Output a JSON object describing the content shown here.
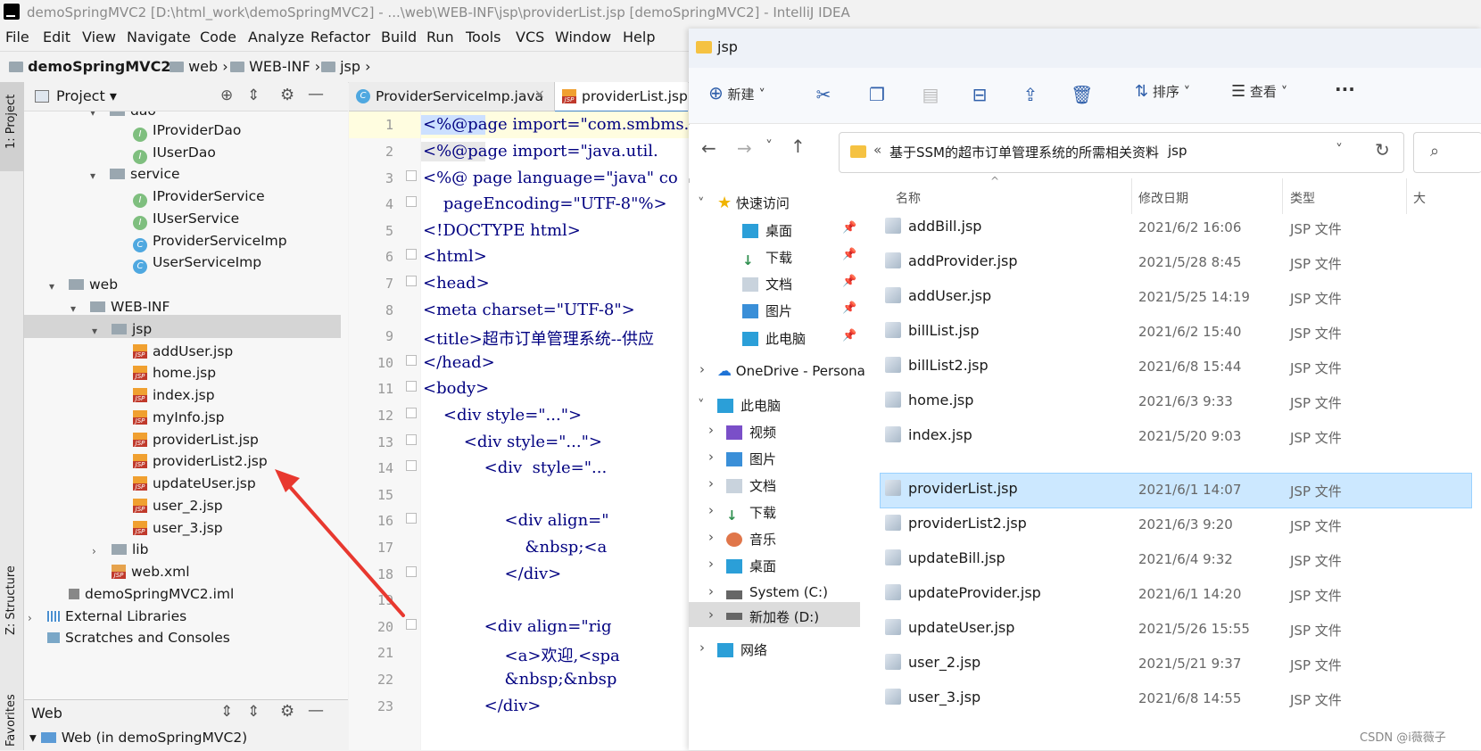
{
  "ide": {
    "title": "demoSpringMVC2 [D:\\html_work\\demoSpringMVC2] - ...\\web\\WEB-INF\\jsp\\providerList.jsp [demoSpringMVC2] - IntelliJ IDEA",
    "menu": [
      "File",
      "Edit",
      "View",
      "Navigate",
      "Code",
      "Analyze",
      "Refactor",
      "Build",
      "Run",
      "Tools",
      "VCS",
      "Window",
      "Help"
    ],
    "breadcrumb": [
      "demoSpringMVC2",
      "web",
      "WEB-INF",
      "jsp"
    ],
    "left_strip": {
      "project": "1: Project",
      "structure": "Z: Structure",
      "favorites": "Favorites"
    },
    "project_panel": {
      "title": "Project",
      "tree": [
        {
          "label": "dao",
          "icon": "folder"
        },
        {
          "label": "IProviderDao",
          "icon": "interface"
        },
        {
          "label": "IUserDao",
          "icon": "interface"
        },
        {
          "label": "service",
          "icon": "folder"
        },
        {
          "label": "IProviderService",
          "icon": "interface"
        },
        {
          "label": "IUserService",
          "icon": "interface"
        },
        {
          "label": "ProviderServiceImp",
          "icon": "class"
        },
        {
          "label": "UserServiceImp",
          "icon": "class"
        },
        {
          "label": "web",
          "icon": "folder"
        },
        {
          "label": "WEB-INF",
          "icon": "folder"
        },
        {
          "label": "jsp",
          "icon": "folder"
        },
        {
          "label": "addUser.jsp",
          "icon": "jsp"
        },
        {
          "label": "home.jsp",
          "icon": "jsp"
        },
        {
          "label": "index.jsp",
          "icon": "jsp"
        },
        {
          "label": "myInfo.jsp",
          "icon": "jsp"
        },
        {
          "label": "providerList.jsp",
          "icon": "jsp"
        },
        {
          "label": "providerList2.jsp",
          "icon": "jsp"
        },
        {
          "label": "updateUser.jsp",
          "icon": "jsp"
        },
        {
          "label": "user_2.jsp",
          "icon": "jsp"
        },
        {
          "label": "user_3.jsp",
          "icon": "jsp"
        },
        {
          "label": "lib",
          "icon": "folder"
        },
        {
          "label": "web.xml",
          "icon": "xml"
        },
        {
          "label": "demoSpringMVC2.iml",
          "icon": "iml"
        },
        {
          "label": "External Libraries",
          "icon": "library"
        },
        {
          "label": "Scratches and Consoles",
          "icon": "scratch"
        }
      ]
    },
    "web_panel": {
      "title": "Web",
      "item": "Web (in demoSpringMVC2)"
    },
    "editor_tabs": [
      "ProviderServiceImp.java",
      "providerList.jsp"
    ],
    "line_numbers": [
      "1",
      "2",
      "3",
      "4",
      "5",
      "6",
      "7",
      "8",
      "9",
      "10",
      "11",
      "12",
      "13",
      "14",
      "15",
      "16",
      "17",
      "18",
      "19",
      "20",
      "21",
      "22",
      "23"
    ],
    "code_lines": [
      "<%@page import=\"com.smbms.",
      "<%@page import=\"java.util.",
      "<%@ page language=\"java\" co",
      "    pageEncoding=\"UTF-8\"%>",
      "<!DOCTYPE html>",
      "<html>",
      "<head>",
      "<meta charset=\"UTF-8\">",
      "<title>超市订单管理系统--供应",
      "</head>",
      "<body>",
      "    <div style=\"...\">",
      "        <div style=\"...\">",
      "            <div  style=\"...",
      "",
      "                <div align=\"",
      "                    &nbsp;<a",
      "                </div>",
      "",
      "            <div align=\"rig",
      "                <a>欢迎,<spa",
      "                &nbsp;&nbsp",
      "            </div>"
    ]
  },
  "explorer": {
    "title": "jsp",
    "commands": {
      "new": "新建",
      "sort": "排序",
      "view": "查看",
      "more": "···"
    },
    "address": {
      "prefix": "«",
      "parent": "基于SSM的超市订单管理系统的所需相关资料",
      "current": "jsp"
    },
    "nav": {
      "quick_access": "快速访问",
      "quick_items": [
        "桌面",
        "下载",
        "文档",
        "图片",
        "此电脑"
      ],
      "onedrive": "OneDrive - Persona",
      "this_pc": "此电脑",
      "pc_items": [
        "视频",
        "图片",
        "文档",
        "下载",
        "音乐",
        "桌面",
        "System (C:)",
        "新加卷 (D:)"
      ],
      "network": "网络"
    },
    "columns": {
      "name": "名称",
      "date": "修改日期",
      "type": "类型",
      "size": "大"
    },
    "files": [
      {
        "name": "addBill.jsp",
        "date": "2021/6/2 16:06",
        "type": "JSP 文件"
      },
      {
        "name": "addProvider.jsp",
        "date": "2021/5/28 8:45",
        "type": "JSP 文件"
      },
      {
        "name": "addUser.jsp",
        "date": "2021/5/25 14:19",
        "type": "JSP 文件"
      },
      {
        "name": "billList.jsp",
        "date": "2021/6/2 15:40",
        "type": "JSP 文件"
      },
      {
        "name": "billList2.jsp",
        "date": "2021/6/8 15:44",
        "type": "JSP 文件"
      },
      {
        "name": "home.jsp",
        "date": "2021/6/3 9:33",
        "type": "JSP 文件"
      },
      {
        "name": "index.jsp",
        "date": "2021/5/20 9:03",
        "type": "JSP 文件"
      },
      {
        "name": "providerList.jsp",
        "date": "2021/6/1 14:07",
        "type": "JSP 文件"
      },
      {
        "name": "providerList2.jsp",
        "date": "2021/6/3 9:20",
        "type": "JSP 文件"
      },
      {
        "name": "updateBill.jsp",
        "date": "2021/6/4 9:32",
        "type": "JSP 文件"
      },
      {
        "name": "updateProvider.jsp",
        "date": "2021/6/1 14:20",
        "type": "JSP 文件"
      },
      {
        "name": "updateUser.jsp",
        "date": "2021/5/26 15:55",
        "type": "JSP 文件"
      },
      {
        "name": "user_2.jsp",
        "date": "2021/5/21 9:37",
        "type": "JSP 文件"
      },
      {
        "name": "user_3.jsp",
        "date": "2021/6/8 14:55",
        "type": "JSP 文件"
      }
    ],
    "selected_file": "providerList.jsp"
  },
  "watermark": "CSDN @i薇薇子",
  "colors": {
    "selection": "#cce8ff",
    "annotation_arrow": "#e8382f",
    "tree_selection": "#d5d5d5"
  }
}
